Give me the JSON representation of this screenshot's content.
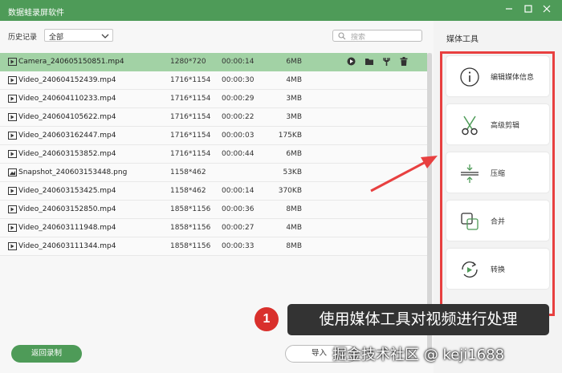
{
  "window": {
    "title": "数据蛙录屏软件",
    "controls": [
      "minimize-icon",
      "maximize-icon",
      "close-icon"
    ]
  },
  "history": {
    "label": "历史记录",
    "filter_value": "全部",
    "search_placeholder": "搜索"
  },
  "files": [
    {
      "name": "Camera_240605150851.mp4",
      "resolution": "1280*720",
      "duration": "00:00:14",
      "size": "6MB",
      "type": "video",
      "selected": true
    },
    {
      "name": "Video_240604152439.mp4",
      "resolution": "1716*1154",
      "duration": "00:00:30",
      "size": "4MB",
      "type": "video"
    },
    {
      "name": "Video_240604110233.mp4",
      "resolution": "1716*1154",
      "duration": "00:00:29",
      "size": "3MB",
      "type": "video"
    },
    {
      "name": "Video_240604105622.mp4",
      "resolution": "1716*1154",
      "duration": "00:00:22",
      "size": "3MB",
      "type": "video"
    },
    {
      "name": "Video_240603162447.mp4",
      "resolution": "1716*1154",
      "duration": "00:00:03",
      "size": "175KB",
      "type": "video"
    },
    {
      "name": "Video_240603153852.mp4",
      "resolution": "1716*1154",
      "duration": "00:00:44",
      "size": "6MB",
      "type": "video"
    },
    {
      "name": "Snapshot_240603153448.png",
      "resolution": "1158*462",
      "duration": "",
      "size": "53KB",
      "type": "image"
    },
    {
      "name": "Video_240603153425.mp4",
      "resolution": "1158*462",
      "duration": "00:00:14",
      "size": "370KB",
      "type": "video"
    },
    {
      "name": "Video_240603152850.mp4",
      "resolution": "1858*1156",
      "duration": "00:00:36",
      "size": "8MB",
      "type": "video"
    },
    {
      "name": "Video_240603111948.mp4",
      "resolution": "1858*1156",
      "duration": "00:00:27",
      "size": "4MB",
      "type": "video"
    },
    {
      "name": "Video_240603111344.mp4",
      "resolution": "1858*1156",
      "duration": "00:00:33",
      "size": "8MB",
      "type": "video"
    }
  ],
  "row_actions": [
    "play-icon",
    "folder-icon",
    "tool-icon",
    "delete-icon"
  ],
  "footer": {
    "back_label": "返回录制",
    "import_label": "导入"
  },
  "media_tools": {
    "title": "媒体工具",
    "items": [
      {
        "label": "编辑媒体信息",
        "icon": "info-icon"
      },
      {
        "label": "高级剪辑",
        "icon": "scissors-icon"
      },
      {
        "label": "压缩",
        "icon": "compress-icon"
      },
      {
        "label": "合并",
        "icon": "merge-icon"
      },
      {
        "label": "转换",
        "icon": "convert-icon"
      }
    ]
  },
  "annotation": {
    "number": "1",
    "text": "使用媒体工具对视频进行处理",
    "watermark": "掘金技术社区 @ keji1688"
  },
  "colors": {
    "brand_green": "#4e9b58",
    "selected_row": "#a2d2a5",
    "highlight_red": "#e84040"
  }
}
